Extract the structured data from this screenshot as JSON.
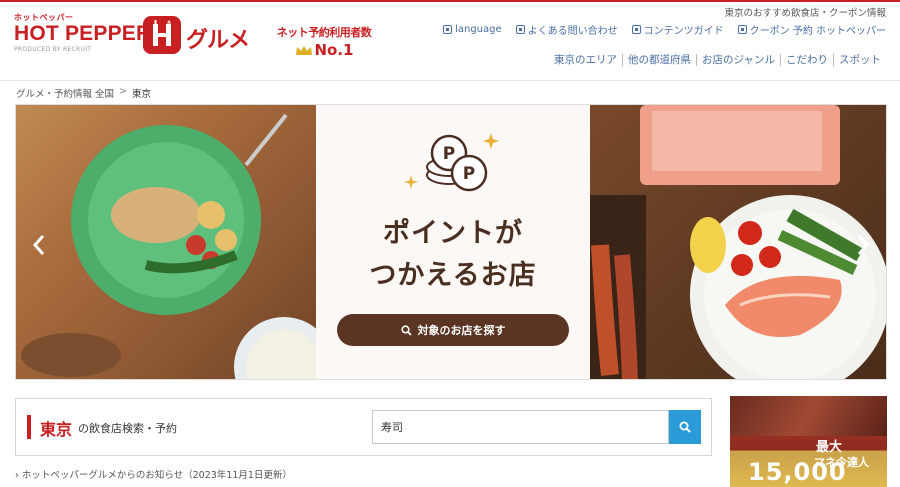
{
  "header": {
    "logo_small": "ホットペッパー",
    "logo_main": "HOT PEPPER",
    "logo_gurume": "グルメ",
    "logo_produced_by": "PRODUCED BY RECRUIT",
    "ranking_line1": "ネット予約利用者数",
    "ranking_line2": "No.1",
    "top_note": "東京のおすすめ飲食店・クーポン情報",
    "util_links": [
      {
        "label": "language",
        "icon": "globe-icon"
      },
      {
        "label": "よくある問い合わせ",
        "icon": "question-icon"
      },
      {
        "label": "コンテンツガイド",
        "icon": "guide-icon"
      },
      {
        "label": "クーポン 予約 ホットペッパー",
        "icon": "chevron-right-icon"
      }
    ],
    "category_nav": [
      "東京のエリア",
      "他の都道府県",
      "お店のジャンル",
      "こだわり",
      "スポット"
    ]
  },
  "breadcrumb": {
    "root": "グルメ・予約情報 全国",
    "separator": ">",
    "current": "東京"
  },
  "banner": {
    "title_line1": "ポイントが",
    "title_line2": "つかえるお店",
    "button_label": "対象のお店を探す",
    "coin_letter": "P"
  },
  "search": {
    "area": "東京",
    "description": "の飲食店検索・予約",
    "input_value": "寿司",
    "button_icon": "search-icon"
  },
  "news": {
    "text": "› ホットペッパーグルメからのお知らせ（2023年11月1日更新）"
  },
  "ad": {
    "line1": "最大",
    "line2": "マネ今達人",
    "number": "15,000"
  },
  "colors": {
    "brand_red": "#c81f22",
    "link_blue": "#4a6fa5",
    "search_blue": "#2b9bd7",
    "banner_brown": "#5a3524"
  }
}
